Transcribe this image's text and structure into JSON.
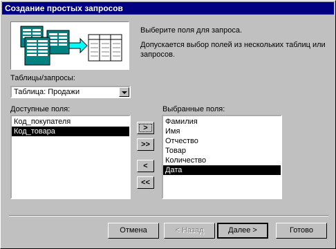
{
  "window": {
    "title": "Создание простых запросов"
  },
  "description": {
    "line1": "Выберите поля для запроса.",
    "line2": "Допускается выбор полей из нескольких таблиц или запросов."
  },
  "tables": {
    "label": "Таблицы/запросы:",
    "selected": "Таблица: Продажи"
  },
  "available": {
    "label": "Доступные поля:",
    "items": [
      "Код_покупателя",
      "Код_товара"
    ],
    "selected_item": "Код_товара"
  },
  "chosen": {
    "label": "Выбранные поля:",
    "items": [
      "Фамилия",
      "Имя",
      "Отчество",
      "Товар",
      "Количество",
      "Дата"
    ],
    "selected_item": "Дата"
  },
  "move_buttons": [
    ">",
    ">>",
    "<",
    "<<"
  ],
  "buttons": {
    "cancel": "Отмена",
    "back": "< Назад",
    "next": "Далее >",
    "finish": "Готово"
  }
}
